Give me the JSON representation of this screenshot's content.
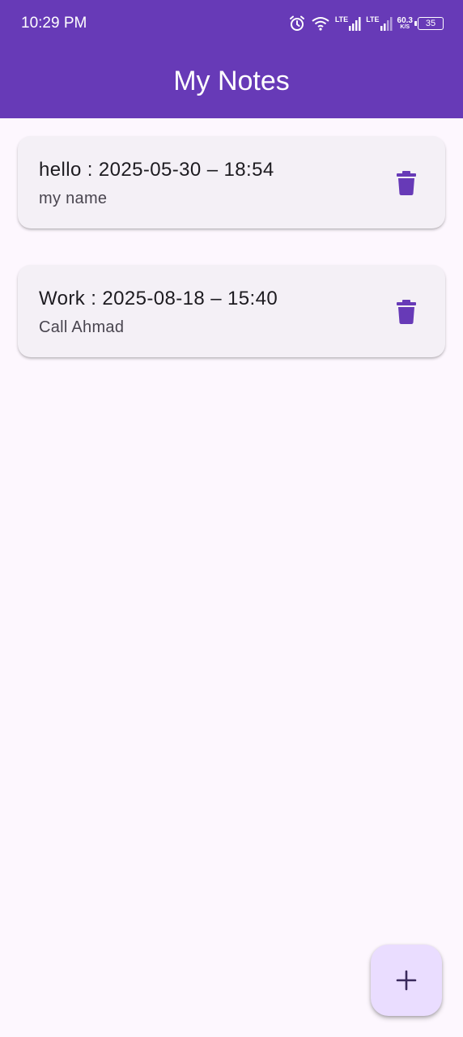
{
  "status_bar": {
    "time": "10:29 PM",
    "network_1": "LTE",
    "network_2": "LTE",
    "speed_value": "60.3",
    "speed_unit": "K/S",
    "battery": "35",
    "icons": [
      "alarm-icon",
      "wifi-icon",
      "signal-icon",
      "signal-icon",
      "battery-icon"
    ]
  },
  "app_bar": {
    "title": "My Notes"
  },
  "notes": [
    {
      "title": "hello : 2025-05-30 – 18:54",
      "content": "my name"
    },
    {
      "title": "Work : 2025-08-18 – 15:40",
      "content": "Call Ahmad"
    }
  ],
  "fab": {
    "icon": "plus-icon"
  },
  "colors": {
    "primary": "#673ab7",
    "background": "#fdf7fe",
    "card": "#f4f0f6",
    "fab": "#eaddff",
    "icon": "#673ab7"
  }
}
